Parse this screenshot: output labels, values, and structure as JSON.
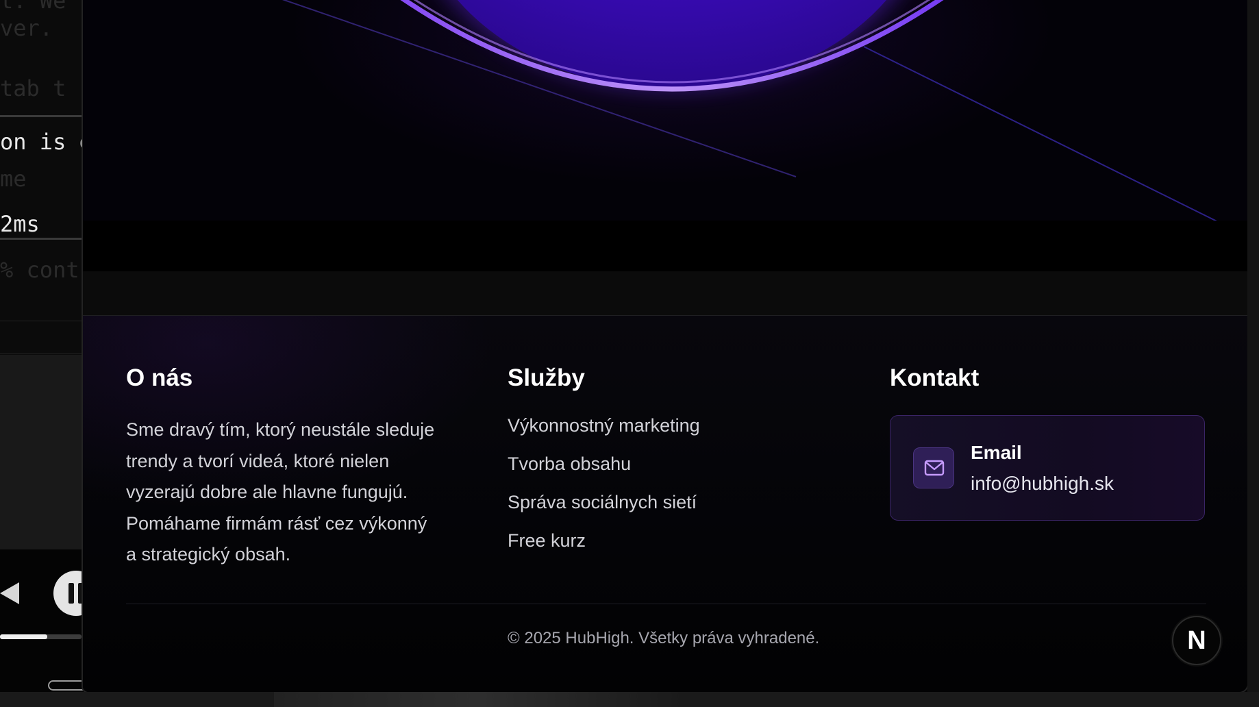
{
  "background_window": {
    "code_lines": [
      {
        "text": "t. We",
        "style": "dim"
      },
      {
        "text": "ver.",
        "style": "dim"
      },
      {
        "text": " tab t",
        "style": "dim"
      },
      {
        "text": "on is de",
        "style": "bright"
      },
      {
        "text": " me",
        "style": "dim"
      },
      {
        "text": "2ms",
        "style": "bright"
      },
      {
        "text": "% cont",
        "style": "dim"
      }
    ],
    "player": {
      "progress": 0.58
    }
  },
  "footer": {
    "about": {
      "title": "O nás",
      "text": "Sme dravý tím, ktorý neustále sleduje trendy a tvorí videá, ktoré nielen vyzerajú dobre ale hlavne fungujú. Pomáhame firmám rásť cez výkonný a strategický obsah."
    },
    "services": {
      "title": "Služby",
      "items": [
        {
          "label": "Výkonnostný marketing"
        },
        {
          "label": "Tvorba obsahu"
        },
        {
          "label": "Správa sociálnych sietí"
        },
        {
          "label": "Free kurz"
        }
      ]
    },
    "contact": {
      "title": "Kontakt",
      "card": {
        "icon": "mail-icon",
        "label": "Email",
        "value": "info@hubhigh.sk"
      }
    },
    "copyright": "© 2025 HubHigh. Všetky práva vyhradené.",
    "badge_letter": "N"
  },
  "colors": {
    "accent_purple": "#6a2cff",
    "card_border": "#3a2466",
    "background": "#030306"
  }
}
